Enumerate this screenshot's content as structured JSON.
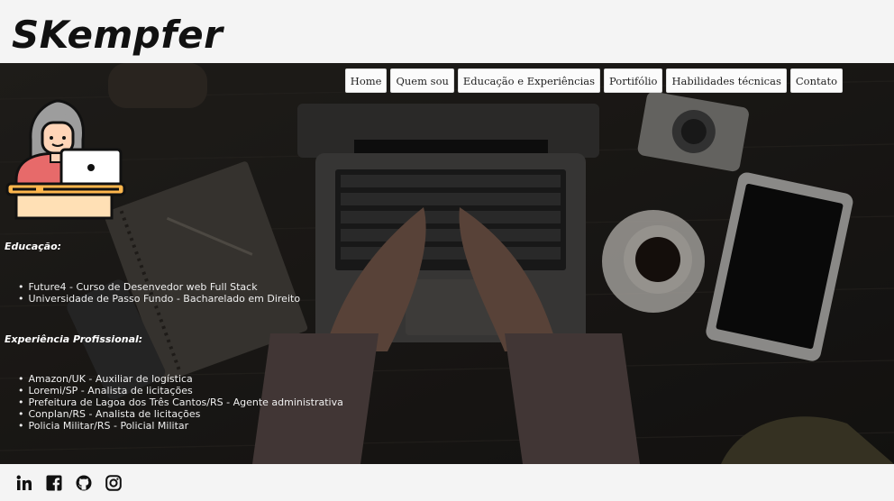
{
  "brand": {
    "logo_text": "SKempfer"
  },
  "nav": {
    "items": [
      {
        "label": "Home"
      },
      {
        "label": "Quem sou"
      },
      {
        "label": "Educação e Experiências"
      },
      {
        "label": "Portifólio"
      },
      {
        "label": "Habilidades técnicas"
      },
      {
        "label": "Contato"
      }
    ]
  },
  "education": {
    "title": "Educação:",
    "items": [
      "Future4 - Curso de Desenvedor web Full Stack",
      "Universidade de Passo Fundo - Bacharelado em Direito"
    ]
  },
  "experience": {
    "title": "Experiência Profissional:",
    "items": [
      "Amazon/UK - Auxiliar de logística",
      "Loremi/SP - Analista de licitações",
      "Prefeitura de Lagoa dos Três Cantos/RS - Agente administrativa",
      "Conplan/RS - Analista de licitações",
      "Policia Militar/RS - Policial Militar"
    ]
  },
  "footer": {
    "social_icons": [
      "linkedin-icon",
      "facebook-icon",
      "github-icon",
      "instagram-icon"
    ]
  },
  "colors": {
    "page_bg": "#f4f4f4",
    "hero_bg": "#1f1d1b",
    "text_light": "#f2f2f2"
  }
}
